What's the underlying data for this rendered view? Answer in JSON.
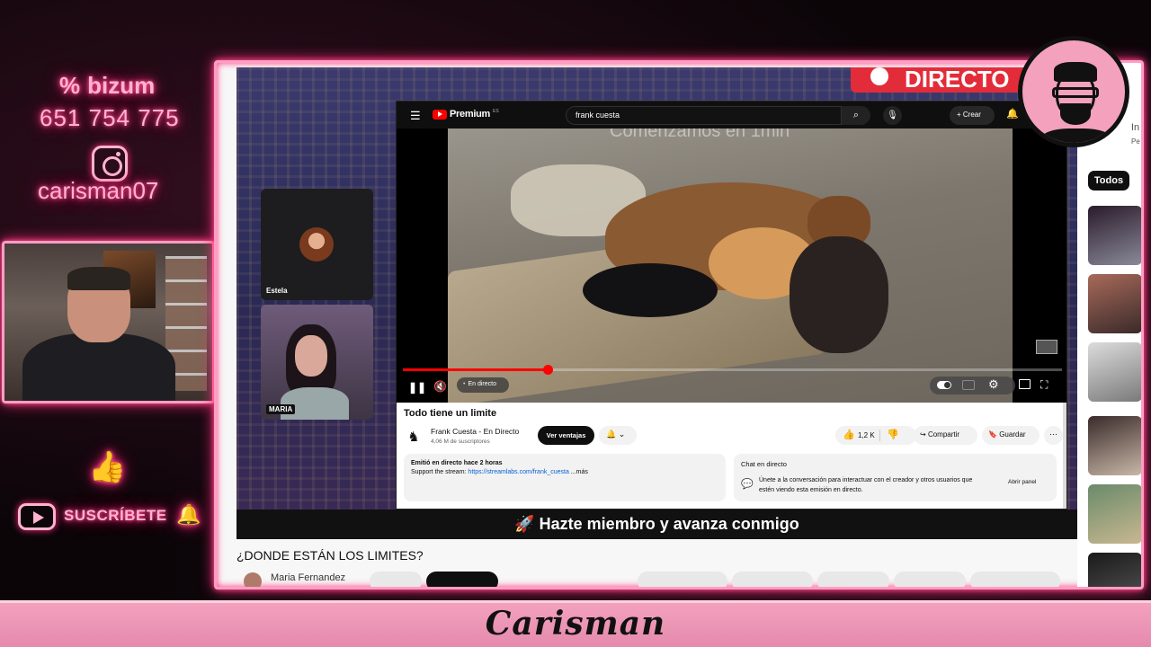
{
  "overlay": {
    "bizum_label": "bizum",
    "bizum_phone": "651 754 775",
    "instagram_user": "carisman07",
    "subscribe_label": "SUSCRÍBETE",
    "brand_name": "Carisman",
    "accent_color": "#ff2d7a"
  },
  "stream": {
    "directo_badge": "DIRECTO",
    "participants": [
      {
        "name": "Estela"
      },
      {
        "name": "MARIA"
      }
    ],
    "subtitle_bar": "🚀 Hazte miembro y avanza conmigo",
    "page_title": "¿DONDE ESTÁN LOS LIMITES?",
    "page_author": "Maria Fernandez"
  },
  "youtube": {
    "logo_text": "Premium",
    "logo_sup": "ES",
    "search_value": "frank cuesta",
    "create_label": "Crear",
    "video_overlay_text": "Comenzamos en 1min",
    "progress": 0.22,
    "live_label": "En directo",
    "video_title": "Todo tiene un limite",
    "channel_name": "Frank Cuesta - En Directo",
    "channel_subs": "4,06 M de suscriptores",
    "join_label": "Ver ventajas",
    "like_count": "1,2 K",
    "share_label": "Compartir",
    "save_label": "Guardar",
    "desc_line1": "Emitió en directo hace 2 horas",
    "desc_prefix": "Support the stream: ",
    "desc_link": "https://streamlabs.com/frank_cuesta",
    "desc_more": " ...más",
    "chat_title": "Chat en directo",
    "chat_desc": "Únete a la conversación para interactuar con el creador y otros usuarios que estén viendo esta emisión en directo.",
    "chat_open_label": "Abrir panel"
  },
  "sidebar": {
    "chip_label": "Todos",
    "side_text_1": "In",
    "side_text_2": "Pe"
  }
}
